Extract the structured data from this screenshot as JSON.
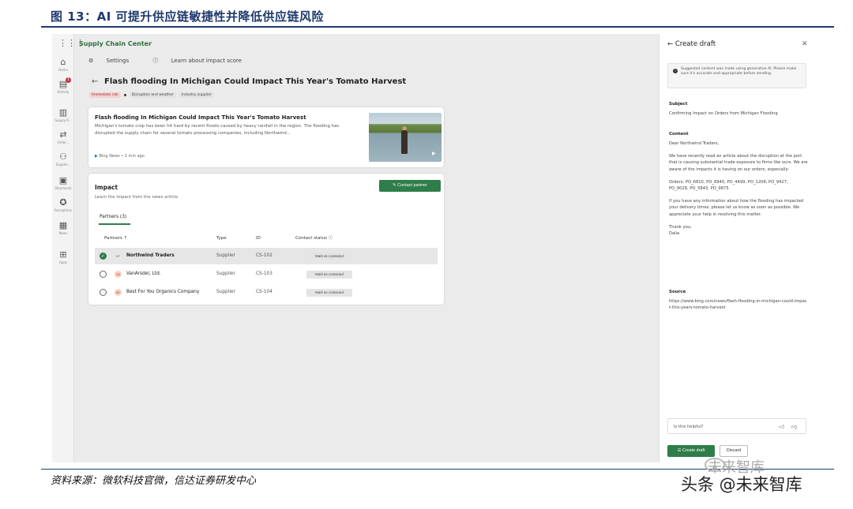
{
  "figure": {
    "title": "图 13：AI 可提升供应链敏捷性并降低供应链风险",
    "source_note": "资料来源：微软科技官微，信达证券研发中心",
    "watermark": "头条 @未来智库",
    "watermark_ghost": "未来智库"
  },
  "app": {
    "title": "Supply Chain Center",
    "settings_label": "Settings",
    "learn_label": "Learn about impact score"
  },
  "rail": {
    "items": [
      {
        "label": "Home",
        "icon": "home-icon"
      },
      {
        "label": "Activity",
        "icon": "bell-icon",
        "badge": "1"
      },
      {
        "label": "Supply R...",
        "icon": "bars-icon"
      },
      {
        "label": "Order...",
        "icon": "orders-icon"
      },
      {
        "label": "Supplie...",
        "icon": "supplier-icon"
      },
      {
        "label": "Shipments",
        "icon": "shipment-icon"
      },
      {
        "label": "Receptions",
        "icon": "reception-icon"
      },
      {
        "label": "News",
        "icon": "news-icon"
      },
      {
        "label": "Apps",
        "icon": "apps-icon"
      }
    ]
  },
  "article": {
    "headline": "Flash flooding In Michigan Could Impact This Year's Tomato Harvest",
    "tags": [
      "Immediate risk",
      "Disruption and weather",
      "Industry supplier"
    ]
  },
  "news": {
    "title": "Flash flooding In Michigan Could Impact This Year's Tomato Harvest",
    "body": "Michigan's tomato crop has been hit hard by recent floods caused by heavy rainfall in the region. The flooding has disrupted the supply chain for several tomato processing companies, including Northwind...",
    "source": "Bing News • 1 min ago"
  },
  "impact": {
    "title": "Impact",
    "subtitle": "Learn the impact from the news article.",
    "contact_button": "Contact partner",
    "partners_tab": "Partners (3)",
    "columns": [
      "Partners ↑",
      "Type",
      "ID",
      "Contact status ⓘ"
    ],
    "rows": [
      {
        "initials": "NT",
        "name": "Northwind Traders",
        "type": "Supplier",
        "id": "CS-102",
        "action": "Mark as contacted",
        "selected": true
      },
      {
        "initials": "VA",
        "name": "VanArsdel, Ltd.",
        "type": "Supplier",
        "id": "CS-103",
        "action": "Mark as contacted",
        "selected": false
      },
      {
        "initials": "BF",
        "name": "Best For You Organics Company",
        "type": "Supplier",
        "id": "CS-104",
        "action": "Mark as contacted",
        "selected": false
      }
    ]
  },
  "draft": {
    "header": "Create draft",
    "ai_note": "Suggested content was made using generative AI. Please make sure it's accurate and appropriate before sending.",
    "subject_label": "Subject",
    "subject": "Confirming Impact on Orders from Michigan Flooding",
    "content_label": "Content",
    "greeting": "Dear Northwind Traders,",
    "para1": "We have recently read an article about the disruption at the port that is causing substantial trade exposure to firms like ours. We are aware of the impacts it is having on our orders, especially:",
    "orders": "Orders: PO_6810, PO_6940, PO_4499, PO_1208, PO_9427, PO_9028, PO_5843, PO_9875",
    "para2": "If you have any information about how the flooding has impacted your delivery times, please let us know as soon as possible. We appreciate your help in resolving this matter.",
    "signoff": "Thank you,",
    "signature": "Dalia",
    "source_label": "Source",
    "source_url": "https://www.bing.com/news/flash-flooding-in-michigan-could-impact-this-years-tomato-harvest",
    "helpful_label": "Is this helpful?",
    "create_button": "Create draft",
    "discard_button": "Discard"
  },
  "colors": {
    "accent": "#2e7d4a",
    "report_blue": "#1f3a6e",
    "risk_red": "#a4262c"
  }
}
